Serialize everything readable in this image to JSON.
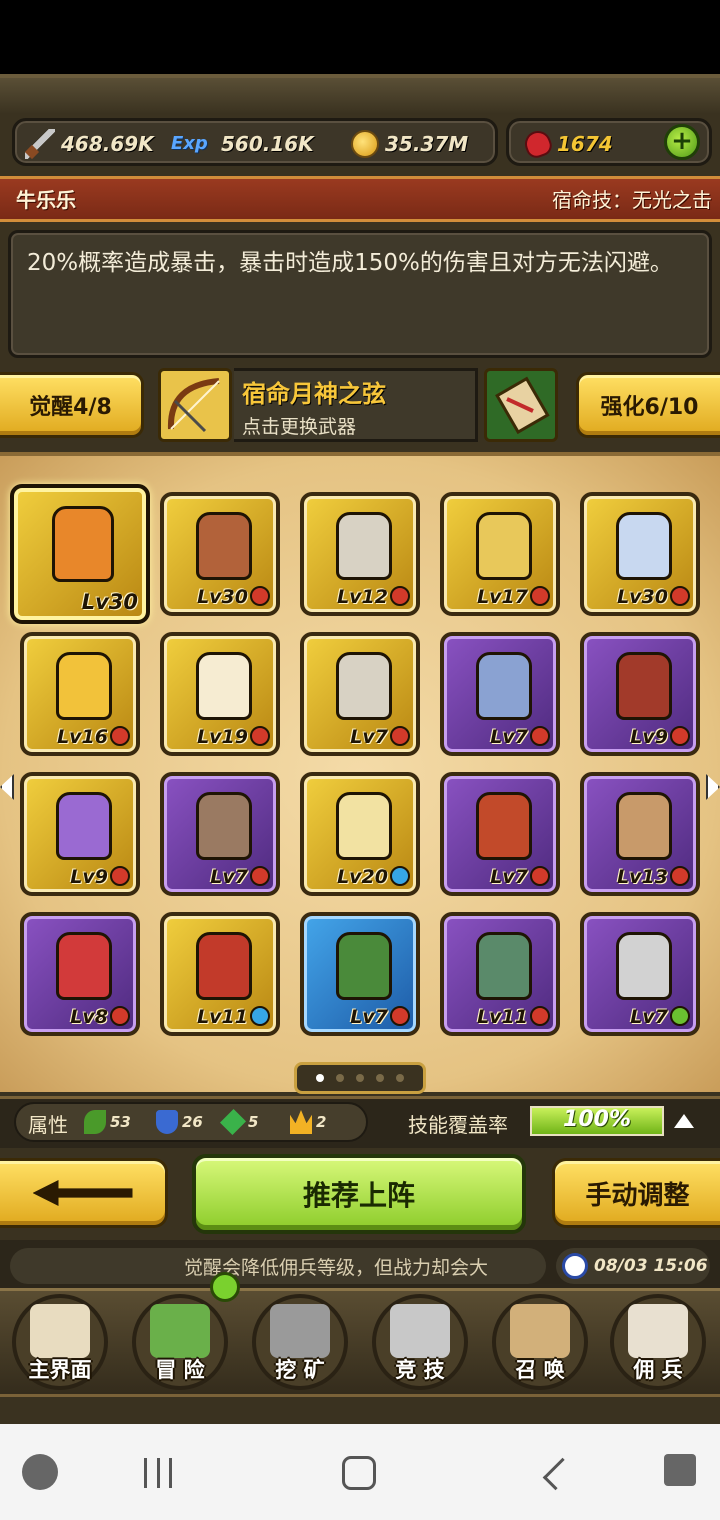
{
  "resources": {
    "attack": "468.69K",
    "exp_icon": "Exp",
    "exp": "560.16K",
    "gold": "35.37M",
    "gems": "1674"
  },
  "hero": {
    "name": "牛乐乐",
    "destiny_skill": "宿命技：无光之击",
    "skill_desc": "20%概率造成暴击，暴击时造成150%的伤害且对方无法闪避。"
  },
  "upgrade": {
    "awaken_label": "觉醒4/8",
    "weapon_name": "宿命月神之弦",
    "weapon_hint": "点击更换武器",
    "enhance_label": "强化6/10"
  },
  "roster": [
    {
      "level": "Lv30",
      "rarity": "gold",
      "badge": "none",
      "selected": true,
      "color": "#e8872a"
    },
    {
      "level": "Lv30",
      "rarity": "gold",
      "badge": "red",
      "color": "#b2623a"
    },
    {
      "level": "Lv12",
      "rarity": "gold",
      "badge": "red",
      "color": "#d8d2c4"
    },
    {
      "level": "Lv17",
      "rarity": "gold",
      "badge": "red",
      "color": "#e8c85a"
    },
    {
      "level": "Lv30",
      "rarity": "gold",
      "badge": "red",
      "color": "#c8d8f0"
    },
    {
      "level": "Lv16",
      "rarity": "gold",
      "badge": "red",
      "color": "#f2c23a"
    },
    {
      "level": "Lv19",
      "rarity": "gold",
      "badge": "red",
      "color": "#f6ecd2"
    },
    {
      "level": "Lv7",
      "rarity": "gold",
      "badge": "red",
      "color": "#d8d2c4"
    },
    {
      "level": "Lv7",
      "rarity": "purple",
      "badge": "red",
      "color": "#8aa2d2"
    },
    {
      "level": "Lv9",
      "rarity": "purple",
      "badge": "red",
      "color": "#a23a2a"
    },
    {
      "level": "Lv9",
      "rarity": "gold",
      "badge": "red",
      "color": "#9a6ad2"
    },
    {
      "level": "Lv7",
      "rarity": "purple",
      "badge": "red",
      "color": "#9a7a62"
    },
    {
      "level": "Lv20",
      "rarity": "gold",
      "badge": "blue",
      "color": "#f2e2a2"
    },
    {
      "level": "Lv7",
      "rarity": "purple",
      "badge": "red",
      "color": "#c24a2a"
    },
    {
      "level": "Lv13",
      "rarity": "purple",
      "badge": "red",
      "color": "#c89a6a"
    },
    {
      "level": "Lv8",
      "rarity": "purple",
      "badge": "red",
      "color": "#d23a3a"
    },
    {
      "level": "Lv11",
      "rarity": "gold",
      "badge": "blue",
      "color": "#c23a2a"
    },
    {
      "level": "Lv7",
      "rarity": "blue",
      "badge": "red",
      "color": "#4a8a3a"
    },
    {
      "level": "Lv11",
      "rarity": "purple",
      "badge": "red",
      "color": "#5a8a6a"
    },
    {
      "level": "Lv7",
      "rarity": "purple",
      "badge": "green",
      "color": "#d2d2d2"
    }
  ],
  "pager": {
    "pages": 5,
    "active": 0
  },
  "attributes": {
    "label": "属性",
    "nature": "53",
    "shield": "26",
    "gem": "5",
    "crown": "2"
  },
  "coverage": {
    "label": "技能覆盖率",
    "value": "100%",
    "fraction": 1.0
  },
  "actions": {
    "recommend": "推荐上阵",
    "manual": "手动调整"
  },
  "ticker": {
    "text": "觉醒会降低佣兵等级，但战力却会大",
    "time": "08/03 15:06"
  },
  "nav": [
    {
      "label": "主界面",
      "icon": "map-scroll-icon",
      "color": "#e8dcc0"
    },
    {
      "label": "冒 险",
      "icon": "island-icon",
      "color": "#6ab04a"
    },
    {
      "label": "挖 矿",
      "icon": "pickaxe-icon",
      "color": "#9a9a9a"
    },
    {
      "label": "竞 技",
      "icon": "crossed-swords-icon",
      "color": "#c8c8c8"
    },
    {
      "label": "召 唤",
      "icon": "summon-scroll-icon",
      "color": "#d2b07a"
    },
    {
      "label": "佣 兵",
      "icon": "tent-icon",
      "color": "#e8e0d0"
    }
  ]
}
